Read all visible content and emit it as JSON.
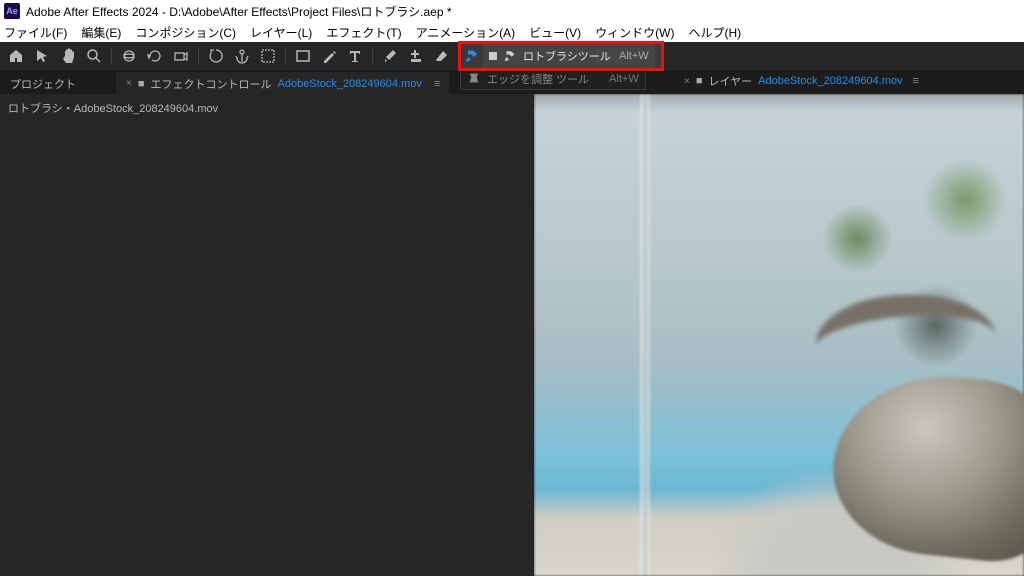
{
  "titlebar": {
    "logo_text": "Ae",
    "title": "Adobe After Effects 2024 - D:\\Adobe\\After Effects\\Project Files\\ロトブラシ.aep *"
  },
  "menubar": {
    "items": [
      "ファイル(F)",
      "編集(E)",
      "コンポジション(C)",
      "レイヤー(L)",
      "エフェクト(T)",
      "アニメーション(A)",
      "ビュー(V)",
      "ウィンドウ(W)",
      "ヘルプ(H)"
    ]
  },
  "roto_dropdown": {
    "items": [
      {
        "label": "ロトブラシツール",
        "shortcut": "Alt+W",
        "selected": true
      }
    ]
  },
  "edge_row": {
    "label": "エッジを調整 ツール",
    "shortcut": "Alt+W"
  },
  "panel_tabs": {
    "left_label": "プロジェクト",
    "middle_prefix": "エフェクトコントロール",
    "middle_link": "AdobeStock_208249604.mov"
  },
  "right_tabs": {
    "prefix": "レイヤー",
    "link": "AdobeStock_208249604.mov"
  },
  "left_panel": {
    "breadcrumb": "ロトブラシ・AdobeStock_208249604.mov"
  }
}
